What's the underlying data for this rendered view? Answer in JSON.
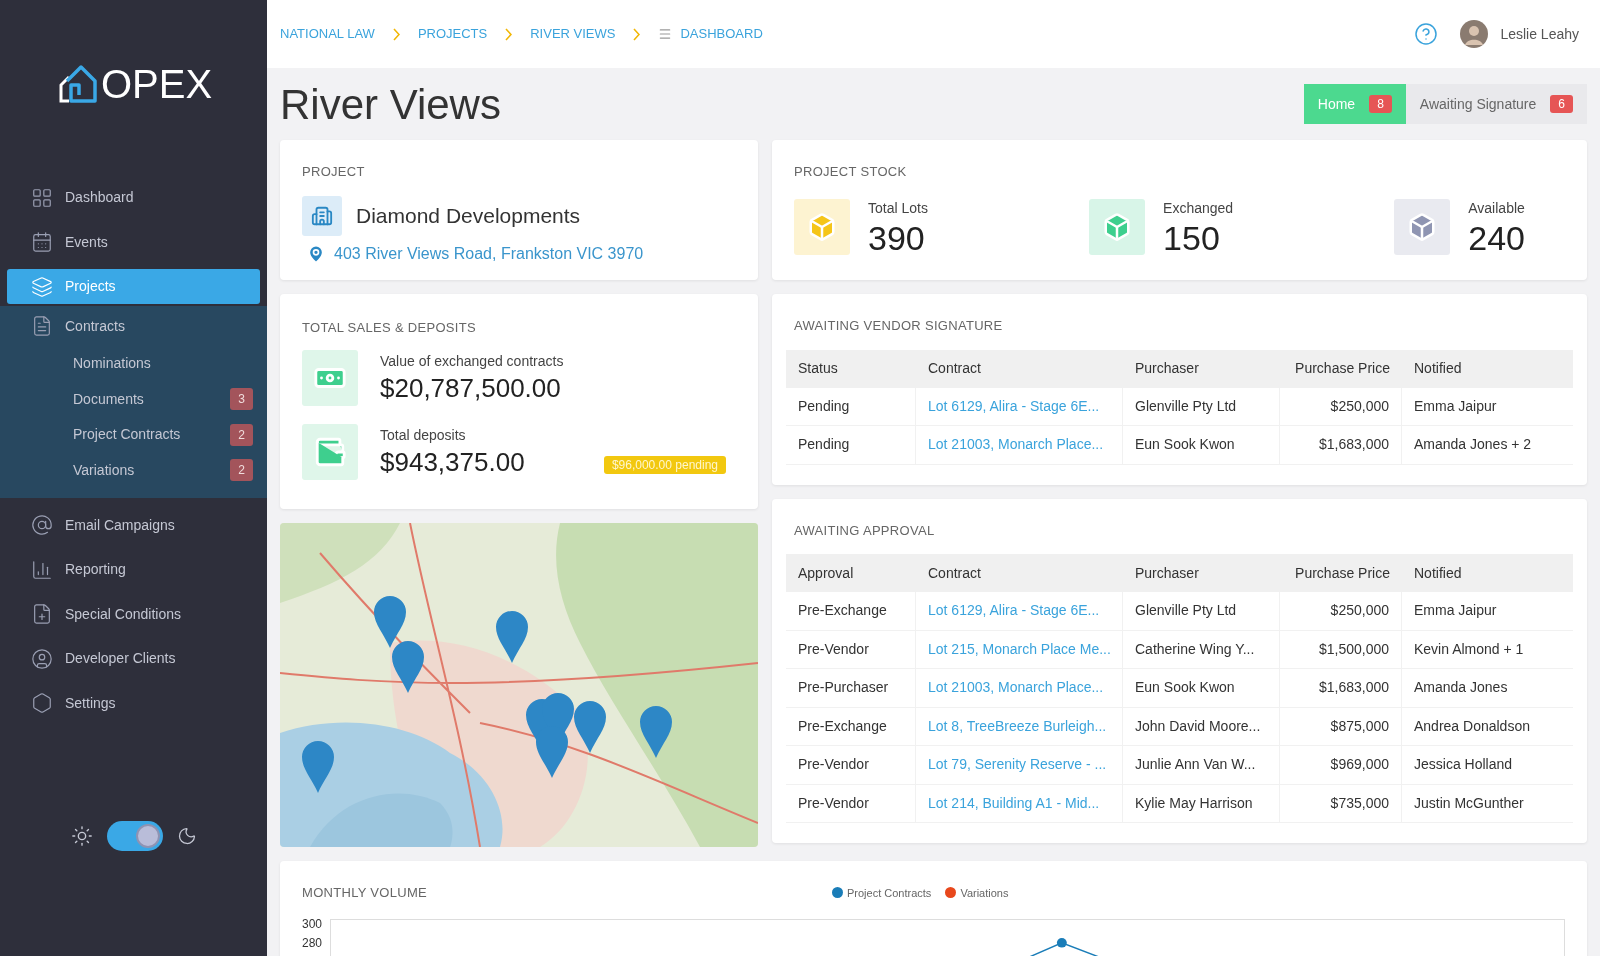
{
  "sidebar": {
    "logo": "OPEX",
    "items": [
      {
        "label": "Dashboard",
        "selected": false
      },
      {
        "label": "Events",
        "selected": false
      },
      {
        "label": "Projects",
        "selected": true
      },
      {
        "label": "Contracts",
        "selected": false,
        "expanded": true,
        "children": [
          {
            "label": "Nominations"
          },
          {
            "label": "Documents",
            "badge": "3"
          },
          {
            "label": "Project Contracts",
            "badge": "2"
          },
          {
            "label": "Variations",
            "badge": "2"
          }
        ]
      },
      {
        "label": "Email Campaigns",
        "selected": false
      },
      {
        "label": "Reporting",
        "selected": false
      },
      {
        "label": "Special Conditions",
        "selected": false
      },
      {
        "label": "Developer Clients",
        "selected": false
      },
      {
        "label": "Settings",
        "selected": false
      }
    ],
    "dark_mode_toggle": {
      "on": true
    }
  },
  "breadcrumbs": [
    {
      "label": "NATIONAL LAW"
    },
    {
      "label": "PROJECTS"
    },
    {
      "label": "RIVER VIEWS"
    },
    {
      "label": "DASHBOARD"
    }
  ],
  "user": {
    "name": "Leslie Leahy"
  },
  "page_title": "River Views",
  "tabs": [
    {
      "label": "Home",
      "count": "8",
      "selected": true
    },
    {
      "label": "Awaiting Signature",
      "count": "6",
      "selected": false
    }
  ],
  "project": {
    "title": "PROJECT",
    "name": "Diamond Developments",
    "address": "403 River Views Road, Frankston VIC 3970"
  },
  "sales": {
    "title": "TOTAL SALES  & DEPOSITS",
    "items": [
      {
        "label": "Value of exchanged contracts",
        "value": "$20,787,500.00"
      },
      {
        "label": "Total deposits",
        "value": "$943,375.00",
        "badge": "$96,000.00 pending"
      }
    ]
  },
  "stock": {
    "title": "PROJECT STOCK",
    "items": [
      {
        "label": "Total Lots",
        "value": "390",
        "color": "#f5c518"
      },
      {
        "label": "Exchanged",
        "value": "150",
        "color": "#3ecf8e"
      },
      {
        "label": "Available",
        "value": "240",
        "color": "#8f95b2"
      }
    ]
  },
  "tables": [
    {
      "title": "AWAITING VENDOR SIGNATURE",
      "columns": [
        "Status",
        "Contract",
        "Purchaser",
        "Purchase Price",
        "Notified"
      ],
      "rows": [
        [
          "Pending",
          "Lot 6129, Alira - Stage 6E...",
          "Glenville Pty Ltd",
          "$250,000",
          "Emma Jaipur"
        ],
        [
          "Pending",
          "Lot 21003, Monarch Place...",
          "Eun Sook Kwon",
          "$1,683,000",
          "Amanda Jones + 2"
        ]
      ]
    },
    {
      "title": "AWAITING APPROVAL",
      "columns": [
        "Approval",
        "Contract",
        "Purchaser",
        "Purchase Price",
        "Notified"
      ],
      "rows": [
        [
          "Pre-Exchange",
          "Lot 6129, Alira - Stage 6E...",
          "Glenville Pty Ltd",
          "$250,000",
          "Emma Jaipur"
        ],
        [
          "Pre-Vendor",
          "Lot 215, Monarch Place Me...",
          "Catherine Wing Y...",
          "$1,500,000",
          "Kevin Almond + 1"
        ],
        [
          "Pre-Purchaser",
          "Lot 21003, Monarch Place...",
          "Eun Sook Kwon",
          "$1,683,000",
          "Amanda Jones"
        ],
        [
          "Pre-Exchange",
          "Lot 8, TreeBreeze Burleigh...",
          "John David Moore...",
          "$875,000",
          "Andrea Donaldson"
        ],
        [
          "Pre-Vendor",
          "Lot 79, Serenity Reserve - ...",
          "Junlie Ann Van W...",
          "$969,000",
          "Jessica Holland"
        ],
        [
          "Pre-Vendor",
          "Lot 214, Building A1 - Mid...",
          "Kylie May Harrison",
          "$735,000",
          "Justin McGunther"
        ]
      ]
    }
  ],
  "monthly_volume": {
    "title": "MONTHLY VOLUME",
    "legend": [
      {
        "label": "Project Contracts",
        "color": "#1a7db8"
      },
      {
        "label": "Variations",
        "color": "#e8481c"
      }
    ],
    "y_tick_labels": [
      "300",
      "280"
    ]
  }
}
